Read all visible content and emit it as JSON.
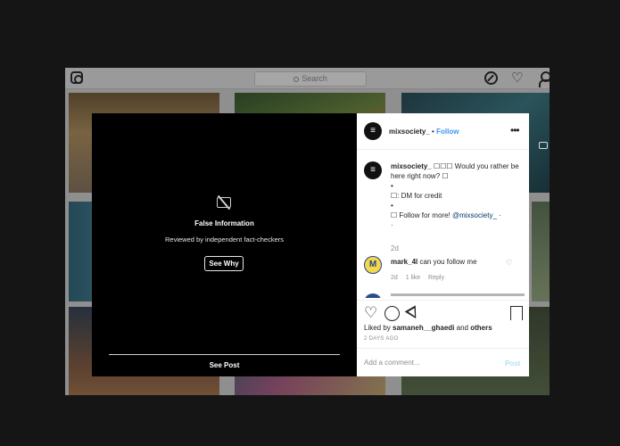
{
  "nav": {
    "search_placeholder": "Search"
  },
  "warning": {
    "title": "False Information",
    "subtitle": "Reviewed by independent fact-checkers",
    "see_why": "See Why",
    "see_post": "See Post"
  },
  "post": {
    "username": "mixsociety_",
    "dot": "•",
    "follow": "Follow",
    "more": "•••",
    "caption_user": "mixsociety_",
    "caption_lines": [
      "☐☐☐ Would you rather be here right now? ☐",
      "•",
      "☐: DM for credit",
      "•",
      "☐ Follow for more!"
    ],
    "mention": "@mixsociety_",
    "caption_tail": "·",
    "caption_end": "·",
    "time": "2d"
  },
  "comment": {
    "username": "mark_4l",
    "text": "can you follow me",
    "time": "2d",
    "likes": "1 like",
    "reply": "Reply"
  },
  "likes": {
    "prefix": "Liked by",
    "user": "samaneh__ghaedi",
    "and": "and",
    "others": "others"
  },
  "posted_ago": "2 DAYS AGO",
  "add_comment": {
    "placeholder": "Add a comment...",
    "post_label": "Post"
  },
  "colors": {
    "accent": "#3897f0",
    "post_disabled": "#b2dffc"
  }
}
